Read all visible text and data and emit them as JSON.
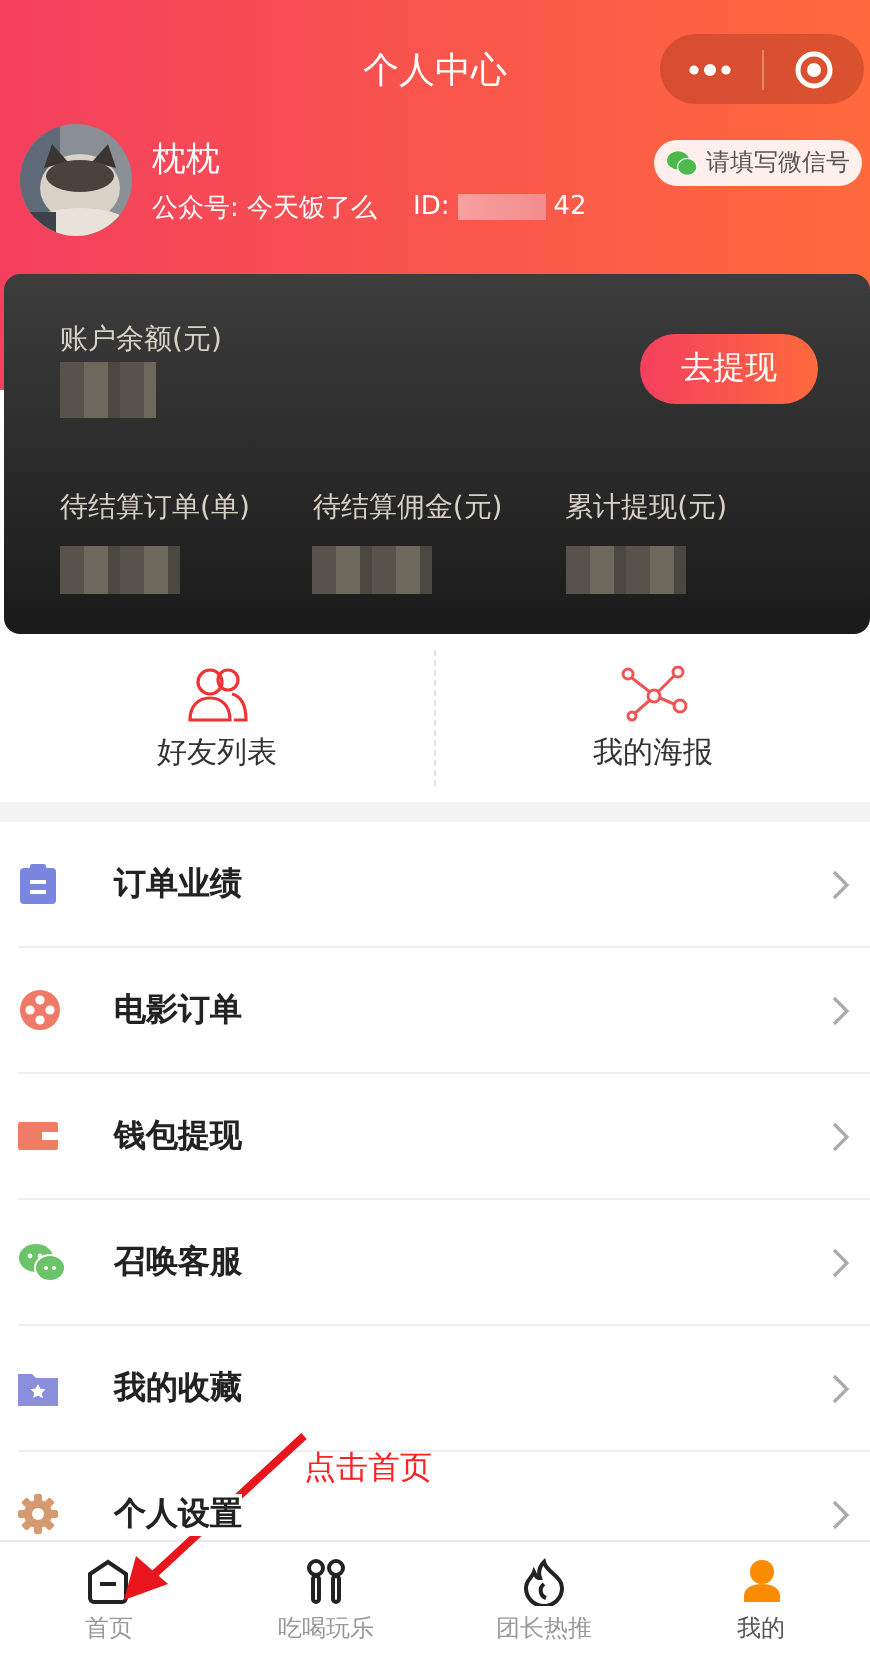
{
  "header": {
    "title": "个人中心",
    "user": {
      "name": "枕枕",
      "account": "公众号: 今天饭了么",
      "id_label": "ID:",
      "id_tail": "42"
    },
    "wechat_button": "请填写微信号"
  },
  "balance_card": {
    "balance_label": "账户余额(元)",
    "withdraw_button": "去提现",
    "stats": [
      {
        "label": "待结算订单(单)"
      },
      {
        "label": "待结算佣金(元)"
      },
      {
        "label": "累计提现(元)"
      }
    ]
  },
  "shortcuts": [
    {
      "label": "好友列表"
    },
    {
      "label": "我的海报"
    }
  ],
  "menu": [
    {
      "label": "订单业绩",
      "color": "#7b86e0"
    },
    {
      "label": "电影订单",
      "color": "#f07a68"
    },
    {
      "label": "钱包提现",
      "color": "#ef7c64"
    },
    {
      "label": "召唤客服",
      "color": "#6cc46a"
    },
    {
      "label": "我的收藏",
      "color": "#8a8fdc"
    },
    {
      "label": "个人设置",
      "color": "#d69a70"
    }
  ],
  "annotation": {
    "text": "点击首页"
  },
  "tabbar": [
    {
      "label": "首页",
      "selected": false
    },
    {
      "label": "吃喝玩乐",
      "selected": false
    },
    {
      "label": "团长热推",
      "selected": false
    },
    {
      "label": "我的",
      "selected": true
    }
  ]
}
